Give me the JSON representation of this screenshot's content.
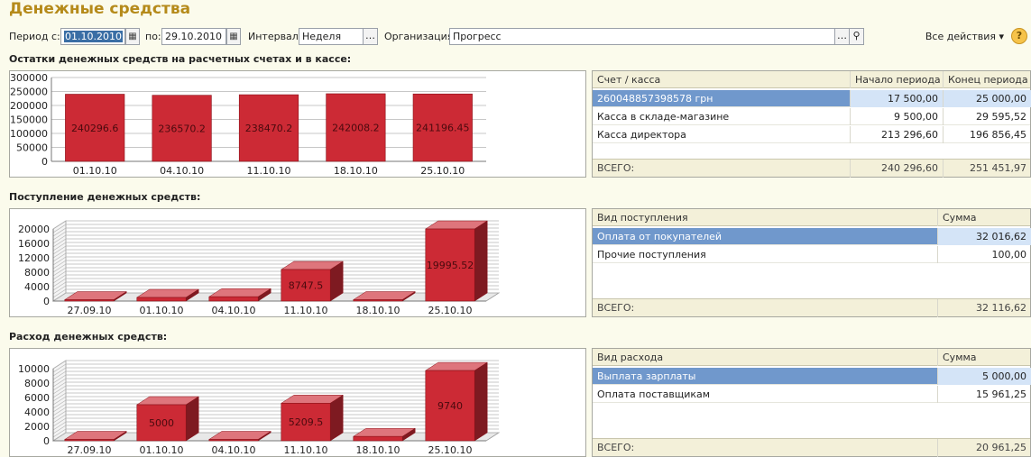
{
  "title": "Денежные средства",
  "filters": {
    "period_from_label": "Период с:",
    "period_from": "01.10.2010",
    "period_to_label": "по:",
    "period_to": "29.10.2010",
    "interval_label": "Интервал:",
    "interval": "Неделя",
    "org_label": "Организация:",
    "org": "Прогресс",
    "all_actions": "Все действия ▾",
    "help": "?"
  },
  "sections": [
    {
      "title": "Остатки денежных средств на расчетных счетах и в кассе:",
      "chart_data": {
        "type": "bar",
        "categories": [
          "01.10.10",
          "04.10.10",
          "11.10.10",
          "18.10.10",
          "25.10.10"
        ],
        "values": [
          240296.6,
          236570.2,
          238470.2,
          242008.2,
          241196.45
        ],
        "labels": [
          "240296.6",
          "236570.2",
          "238470.2",
          "242008.2",
          "241196.45"
        ],
        "ticks": [
          "0",
          "50000",
          "100000",
          "150000",
          "200000",
          "250000",
          "300000"
        ],
        "ylim": [
          0,
          300000
        ],
        "three_d": false,
        "color": "#cc2a35"
      },
      "table": {
        "headers": [
          "Счет / касса",
          "Начало периода",
          "Конец периода"
        ],
        "rows": [
          [
            "260048857398578 грн",
            "17 500,00",
            "25 000,00"
          ],
          [
            "Касса в складе-магазине",
            "9 500,00",
            "29 595,52"
          ],
          [
            "Касса директора",
            "213 296,60",
            "196 856,45"
          ]
        ],
        "total": [
          "ВСЕГО:",
          "240 296,60",
          "251 451,97"
        ]
      }
    },
    {
      "title": "Поступление денежных средств:",
      "chart_data": {
        "type": "bar",
        "categories": [
          "27.09.10",
          "01.10.10",
          "04.10.10",
          "11.10.10",
          "18.10.10",
          "25.10.10"
        ],
        "values": [
          0,
          1000,
          1200,
          8747.5,
          0,
          19995.52
        ],
        "labels": [
          "",
          "",
          "",
          "8747.5",
          "",
          "19995.52"
        ],
        "ticks": [
          "0",
          "4000",
          "8000",
          "12000",
          "16000",
          "20000"
        ],
        "ylim": [
          0,
          20000
        ],
        "three_d": true,
        "color": "#cc2a35"
      },
      "table": {
        "headers": [
          "Вид поступления",
          "Сумма"
        ],
        "rows": [
          [
            "Оплата от покупателей",
            "32 016,62"
          ],
          [
            "Прочие поступления",
            "100,00"
          ]
        ],
        "total": [
          "ВСЕГО:",
          "32 116,62"
        ]
      }
    },
    {
      "title": "Расход денежных средств:",
      "chart_data": {
        "type": "bar",
        "categories": [
          "27.09.10",
          "01.10.10",
          "04.10.10",
          "11.10.10",
          "18.10.10",
          "25.10.10"
        ],
        "values": [
          0,
          5000,
          0,
          5209.5,
          600,
          9740
        ],
        "labels": [
          "",
          "5000",
          "",
          "5209.5",
          "",
          "9740"
        ],
        "ticks": [
          "0",
          "2000",
          "4000",
          "6000",
          "8000",
          "10000"
        ],
        "ylim": [
          0,
          10000
        ],
        "three_d": true,
        "color": "#cc2a35"
      },
      "table": {
        "headers": [
          "Вид расхода",
          "Сумма"
        ],
        "rows": [
          [
            "Выплата зарплаты",
            "5 000,00"
          ],
          [
            "Оплата поставщикам",
            "15 961,25"
          ]
        ],
        "total": [
          "ВСЕГО:",
          "20 961,25"
        ]
      }
    }
  ]
}
